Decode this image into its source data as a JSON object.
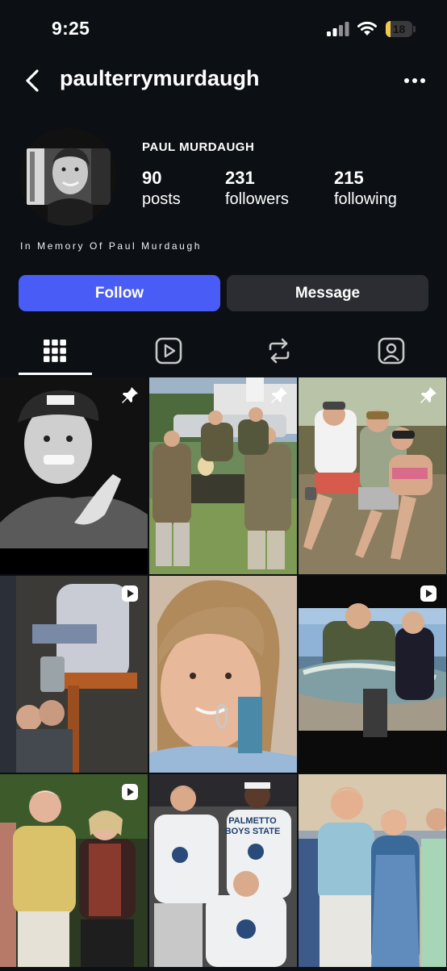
{
  "status_bar": {
    "time": "9:25",
    "battery_percent": "18",
    "battery_level": 0.18
  },
  "header": {
    "username": "paulterrymurdaugh"
  },
  "profile": {
    "display_name": "PAUL MURDAUGH",
    "stats": [
      {
        "value": "90",
        "label": "posts"
      },
      {
        "value": "231",
        "label": "followers"
      },
      {
        "value": "215",
        "label": "following"
      }
    ],
    "bio": "In Memory Of Paul Murdaugh"
  },
  "actions": {
    "follow_label": "Follow",
    "message_label": "Message"
  },
  "tabs": [
    {
      "name": "grid-icon",
      "active": true
    },
    {
      "name": "reels-icon",
      "active": false
    },
    {
      "name": "reposts-icon",
      "active": false
    },
    {
      "name": "tagged-icon",
      "active": false
    }
  ],
  "colors": {
    "background": "#0c0f14",
    "follow": "#4a5cf6",
    "message": "#2c2d33"
  },
  "posts": [
    {
      "kind": "photo",
      "badge": "pin-icon"
    },
    {
      "kind": "photo",
      "badge": "pin-icon"
    },
    {
      "kind": "photo",
      "badge": "pin-icon"
    },
    {
      "kind": "video",
      "badge": "reel-icon"
    },
    {
      "kind": "photo",
      "badge": ""
    },
    {
      "kind": "video",
      "badge": "reel-icon"
    },
    {
      "kind": "video",
      "badge": "reel-icon"
    },
    {
      "kind": "photo",
      "badge": "",
      "visible_text": [
        "PALMETTO BOYS STATE"
      ]
    },
    {
      "kind": "photo",
      "badge": ""
    }
  ]
}
